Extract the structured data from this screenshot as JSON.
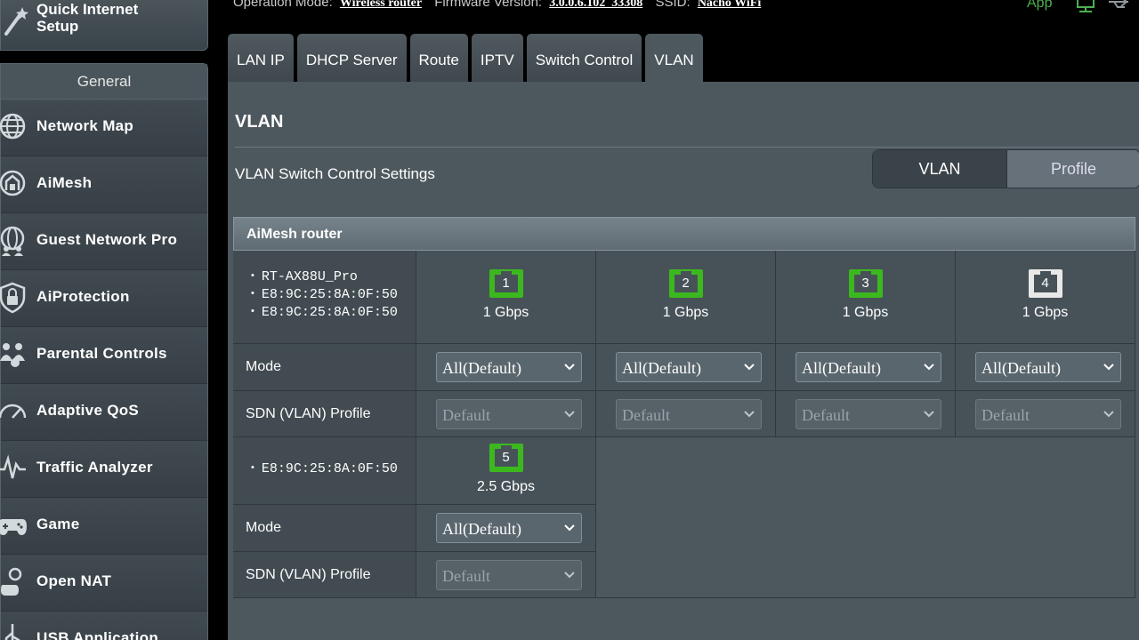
{
  "quick_setup": {
    "label": "Quick Internet Setup"
  },
  "sidebar": {
    "section": "General",
    "items": [
      {
        "label": "Network Map",
        "icon": "globe-icon"
      },
      {
        "label": "AiMesh",
        "icon": "aimesh-icon"
      },
      {
        "label": "Guest Network Pro",
        "icon": "guest-network-icon"
      },
      {
        "label": "AiProtection",
        "icon": "shield-lock-icon"
      },
      {
        "label": "Parental Controls",
        "icon": "family-icon"
      },
      {
        "label": "Adaptive QoS",
        "icon": "speedometer-icon"
      },
      {
        "label": "Traffic Analyzer",
        "icon": "pulse-icon"
      },
      {
        "label": "Game",
        "icon": "gamepad-icon"
      },
      {
        "label": "Open NAT",
        "icon": "open-nat-icon"
      },
      {
        "label": "USB Application",
        "icon": "usb-icon"
      }
    ]
  },
  "topbar": {
    "mode_label": "Operation Mode:",
    "mode_value": "Wireless router",
    "fw_label": "Firmware Version:",
    "fw_value": "3.0.0.6.102_33308",
    "ssid_label": "SSID:",
    "ssid_value": "Nacho WiFi",
    "app_label": "App"
  },
  "tabs": [
    {
      "label": "LAN IP"
    },
    {
      "label": "DHCP Server"
    },
    {
      "label": "Route"
    },
    {
      "label": "IPTV"
    },
    {
      "label": "Switch Control"
    },
    {
      "label": "VLAN",
      "active": true
    }
  ],
  "page": {
    "title": "VLAN",
    "section_title": "VLAN Switch Control Settings",
    "toggle": {
      "left": "VLAN",
      "right": "Profile",
      "selected": "VLAN"
    }
  },
  "table": {
    "header": "AiMesh router",
    "device1": [
      "RT-AX88U_Pro",
      "E8:9C:25:8A:0F:50",
      "E8:9C:25:8A:0F:50"
    ],
    "device2": [
      "E8:9C:25:8A:0F:50"
    ],
    "mode_label": "Mode",
    "profile_label": "SDN (VLAN) Profile",
    "ports_row1": [
      {
        "num": "1",
        "speed": "1 Gbps",
        "connected": true,
        "mode": "All(Default)",
        "profile": "Default"
      },
      {
        "num": "2",
        "speed": "1 Gbps",
        "connected": true,
        "mode": "All(Default)",
        "profile": "Default"
      },
      {
        "num": "3",
        "speed": "1 Gbps",
        "connected": true,
        "mode": "All(Default)",
        "profile": "Default"
      },
      {
        "num": "4",
        "speed": "1 Gbps",
        "connected": false,
        "mode": "All(Default)",
        "profile": "Default"
      }
    ],
    "ports_row2": [
      {
        "num": "5",
        "speed": "2.5 Gbps",
        "connected": true,
        "mode": "All(Default)",
        "profile": "Default"
      }
    ]
  },
  "colors": {
    "port_connected": "#3cb81f",
    "port_idle": "#e8e8e8",
    "accent_green": "#4caf50"
  }
}
